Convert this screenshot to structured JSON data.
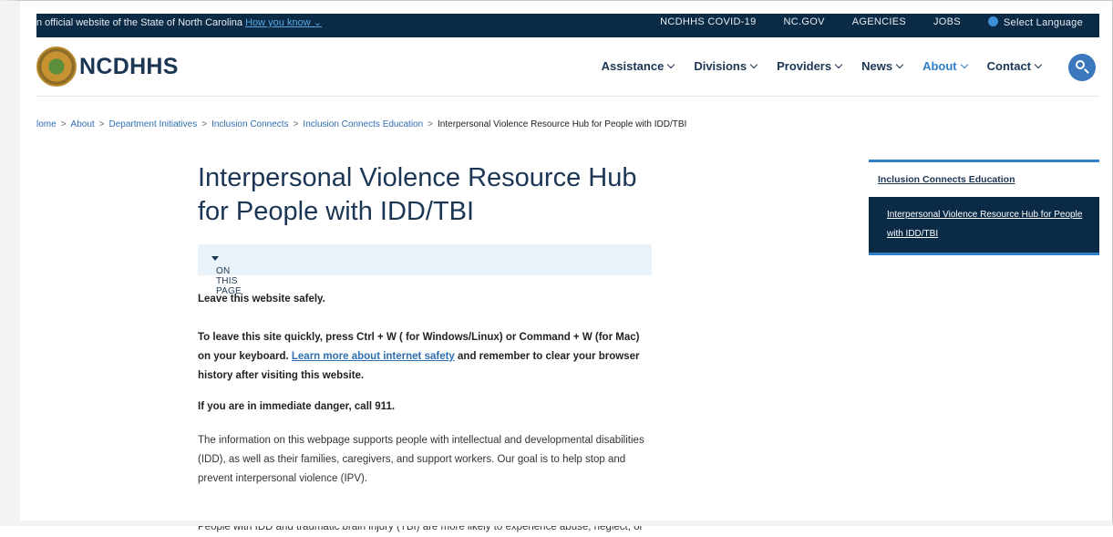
{
  "utility": {
    "official_text": "n official website of the State of North Carolina",
    "how_link": "How you know ⌄",
    "links": [
      "NCDHHS COVID-19",
      "NC.GOV",
      "AGENCIES",
      "JOBS"
    ],
    "language": "Select Language"
  },
  "header": {
    "brand": "NCDHHS",
    "nav": [
      {
        "label": "Assistance"
      },
      {
        "label": "Divisions"
      },
      {
        "label": "Providers"
      },
      {
        "label": "News"
      },
      {
        "label": "About"
      },
      {
        "label": "Contact"
      }
    ],
    "active_nav": "About",
    "accent_color": "#2f7fc8",
    "brand_color": "#1b3554"
  },
  "breadcrumb": {
    "items": [
      "lome",
      "About",
      "Department Initiatives",
      "Inclusion Connects",
      "Inclusion Connects Education"
    ],
    "current": "Interpersonal Violence Resource Hub for People with IDD/TBI",
    "separator": ">"
  },
  "page": {
    "title": "Interpersonal Violence Resource Hub for People with IDD/TBI",
    "on_this_page": "ON THIS PAGE",
    "leave_safely": "Leave this website safely.",
    "leave_quick_1": "To leave this site quickly, press Ctrl + W ( for Windows/Linux) or Command + W  (for Mac) on your keyboard.",
    "internet_safety_link": "Learn more about internet safety",
    "leave_quick_2": "and remember to clear your browser history after visiting this website.",
    "danger": "If you are in immediate danger, call 911.",
    "intro": "The information on this webpage supports people with intellectual and developmental disabilities (IDD), as well as their families, caregivers, and support workers. Our goal is to help stop and prevent interpersonal violence (IPV).",
    "partial": "People with IDD and traumatic brain injury (TBI) are more likely to experience abuse, neglect, or"
  },
  "sidebar": {
    "parent": "Inclusion Connects Education",
    "current": "Interpersonal Violence Resource Hub for People with IDD/TBI"
  }
}
